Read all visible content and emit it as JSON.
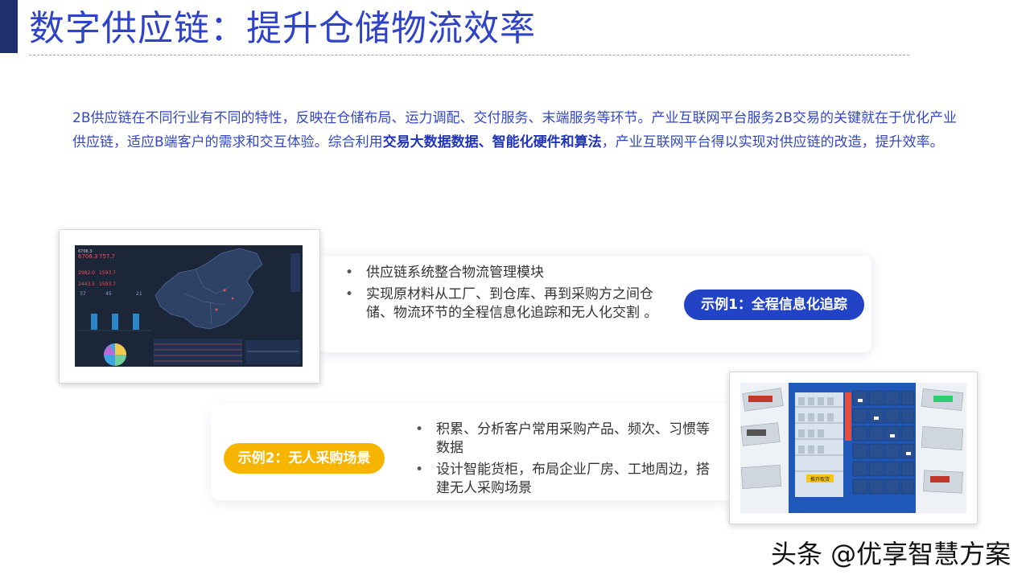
{
  "header": {
    "title": "数字供应链：提升仓储物流效率"
  },
  "intro": {
    "part1": "2B供应链在不同行业有不同的特性，反映在仓储布局、运力调配、交付服务、末端服务等环节。产业互联网平台服务2B交易的关键就在于优化产业供应链，适应B端客户的需求和交互体验。综合利用",
    "emphasis": "交易大数据数据、智能化硬件和算法",
    "part2": "，产业互联网平台得以实现对供应链的改造，提升效率。"
  },
  "example1": {
    "label": "示例1：全程信息化追踪",
    "bullets": [
      "供应链系统整合物流管理模块",
      "实现原材料从工厂、到仓库、再到采购方之间仓储、物流环节的全程信息化追踪和无人化交割 。"
    ]
  },
  "example2": {
    "label": "示例2：无人采购场景",
    "bullets": [
      "积累、分析客户常用采购产品、频次、习惯等数据",
      "设计智能货柜，布局企业厂房、工地周边，搭建无人采购场景"
    ],
    "vending_button": "推开取货"
  },
  "dashboard": {
    "stats": [
      "6706.3",
      "757.7",
      "2982.0",
      "1593.7",
      "2443.5",
      "1593.7",
      "37",
      "45",
      "21"
    ]
  },
  "watermark": "头条 @优享智慧方案",
  "colors": {
    "title": "#2f43c9",
    "accent_bar": "#1f2e6e",
    "pill1": "#2343c6",
    "pill2": "#f7b500",
    "dashboard_bg": "#1b2638"
  }
}
